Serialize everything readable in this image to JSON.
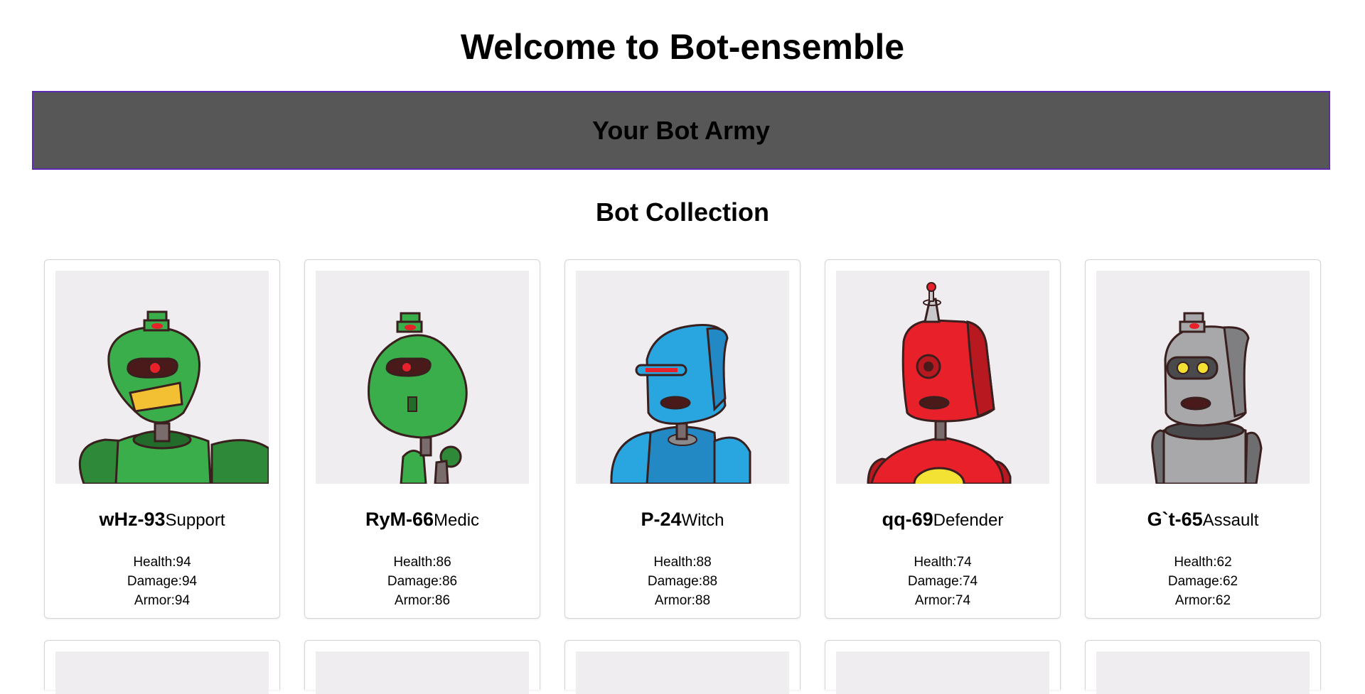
{
  "header": {
    "title": "Welcome to Bot-ensemble"
  },
  "army": {
    "title": "Your Bot Army"
  },
  "collection": {
    "title": "Bot Collection",
    "bots": [
      {
        "name": "wHz-93",
        "class": "Support",
        "health": "94",
        "damage": "94",
        "armor": "94",
        "color": "#3aae4a",
        "portrait": "green-grin-robot"
      },
      {
        "name": "RyM-66",
        "class": "Medic",
        "health": "86",
        "damage": "86",
        "armor": "86",
        "color": "#3aae4a",
        "portrait": "green-slim-robot"
      },
      {
        "name": "P-24",
        "class": "Witch",
        "health": "88",
        "damage": "88",
        "armor": "88",
        "color": "#29a6e0",
        "portrait": "blue-visor-robot"
      },
      {
        "name": "qq-69",
        "class": "Defender",
        "health": "74",
        "damage": "74",
        "armor": "74",
        "color": "#e8202a",
        "portrait": "red-antenna-robot"
      },
      {
        "name": "G`t-65",
        "class": "Assault",
        "health": "62",
        "damage": "62",
        "armor": "62",
        "color": "#a8a8aa",
        "portrait": "gray-robot"
      }
    ],
    "stat_labels": {
      "health": "Health:",
      "damage": "Damage:",
      "armor": "Armor:"
    }
  }
}
